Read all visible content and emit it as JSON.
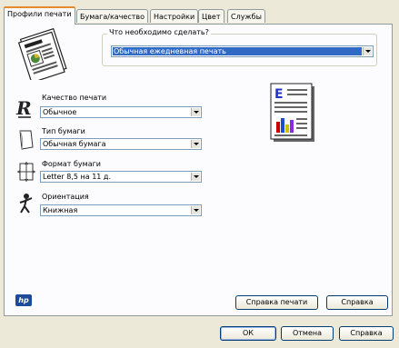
{
  "tabs": [
    {
      "label": "Профили печати",
      "active": true
    },
    {
      "label": "Бумага/качество",
      "active": false
    },
    {
      "label": "Настройки",
      "active": false
    },
    {
      "label": "Цвет",
      "active": false
    },
    {
      "label": "Службы",
      "active": false
    }
  ],
  "task": {
    "group_label": "Что необходимо сделать?",
    "selected": "Обычная ежедневная печать"
  },
  "print_quality": {
    "label": "Качество печати",
    "value": "Обычное"
  },
  "paper_type": {
    "label": "Тип бумаги",
    "value": "Обычная бумага"
  },
  "paper_size": {
    "label": "Формат бумаги",
    "value": "Letter 8,5 на 11 д."
  },
  "orientation": {
    "label": "Ориентация",
    "value": "Книжная"
  },
  "preview": {
    "letter": "E"
  },
  "logo": {
    "text": "hp"
  },
  "buttons": {
    "print_help": "Справка печати",
    "help": "Справка",
    "ok": "ОК",
    "cancel": "Отмена",
    "help_bottom": "Справка"
  },
  "colors": {
    "selection": "#316ac5",
    "tab_highlight": "#e68b2c",
    "hp_blue": "#1d4a9a"
  }
}
